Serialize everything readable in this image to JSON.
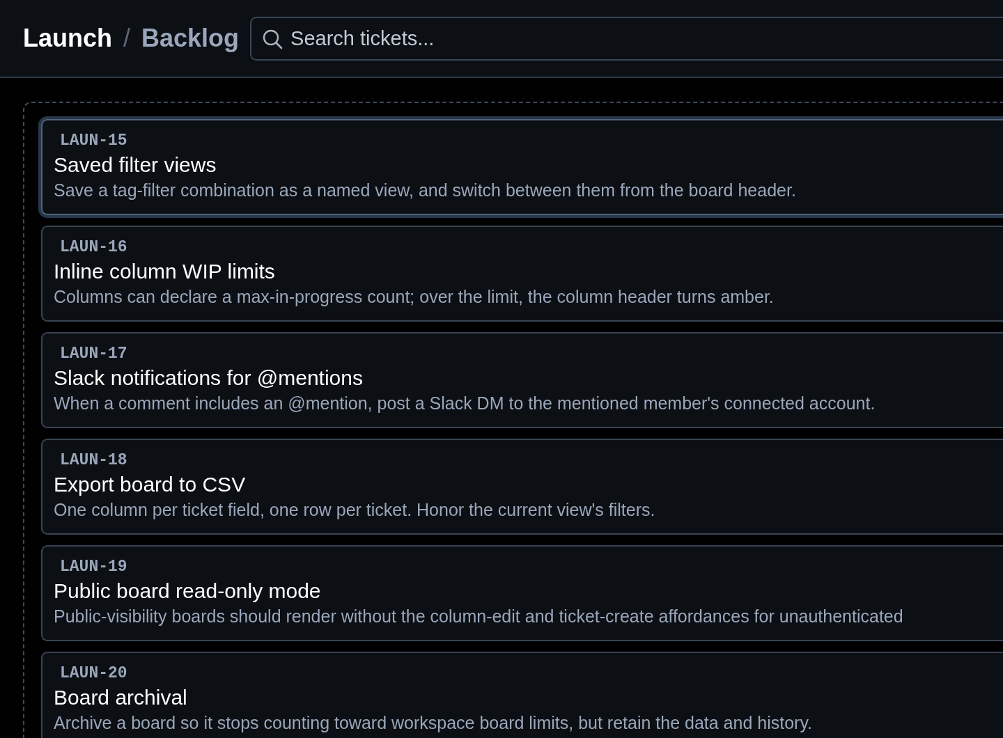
{
  "breadcrumb": {
    "project": "Launch",
    "separator": "/",
    "board": "Backlog"
  },
  "search": {
    "placeholder": "Search tickets..."
  },
  "tickets": [
    {
      "id": "LAUN-15",
      "title": "Saved filter views",
      "description": "Save a tag-filter combination as a named view, and switch between them from the board header.",
      "selected": true
    },
    {
      "id": "LAUN-16",
      "title": "Inline column WIP limits",
      "description": "Columns can declare a max-in-progress count; over the limit, the column header turns amber.",
      "selected": false
    },
    {
      "id": "LAUN-17",
      "title": "Slack notifications for @mentions",
      "description": "When a comment includes an @mention, post a Slack DM to the mentioned member's connected account.",
      "selected": false
    },
    {
      "id": "LAUN-18",
      "title": "Export board to CSV",
      "description": "One column per ticket field, one row per ticket. Honor the current view's filters.",
      "selected": false
    },
    {
      "id": "LAUN-19",
      "title": "Public board read-only mode",
      "description": "Public-visibility boards should render without the column-edit and ticket-create affordances for unauthenticated",
      "selected": false
    },
    {
      "id": "LAUN-20",
      "title": "Board archival",
      "description": "Archive a board so it stops counting toward workspace board limits, but retain the data and history.",
      "selected": false
    }
  ]
}
